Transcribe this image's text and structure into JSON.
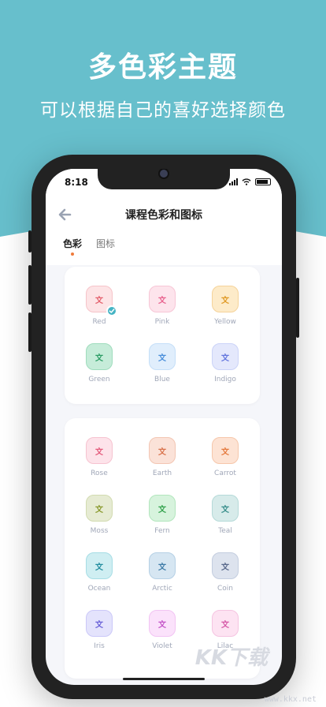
{
  "promo": {
    "title": "多色彩主题",
    "subtitle": "可以根据自己的喜好选择颜色"
  },
  "status": {
    "time": "8:18"
  },
  "nav": {
    "title": "课程色彩和图标",
    "tabs": [
      {
        "label": "色彩",
        "active": true
      },
      {
        "label": "图标",
        "active": false
      }
    ]
  },
  "glyph": "文",
  "card1": [
    {
      "label": "Red",
      "bg": "#fde4e6",
      "fg": "#e4606c",
      "border": "#f6c4c9",
      "selected": true
    },
    {
      "label": "Pink",
      "bg": "#fde4ec",
      "fg": "#e8628e",
      "border": "#f7c6d6",
      "selected": false
    },
    {
      "label": "Yellow",
      "bg": "#fdebc9",
      "fg": "#e09a26",
      "border": "#f5d39a",
      "selected": false
    },
    {
      "label": "Green",
      "bg": "#c6ecd9",
      "fg": "#2d9d66",
      "border": "#9fdcbd",
      "selected": false
    },
    {
      "label": "Blue",
      "bg": "#e0eefc",
      "fg": "#4a8fdb",
      "border": "#c5dff8",
      "selected": false
    },
    {
      "label": "Indigo",
      "bg": "#e4e8fc",
      "fg": "#6476de",
      "border": "#cbd3f8",
      "selected": false
    }
  ],
  "card2": [
    {
      "label": "Rose",
      "bg": "#fde3ea",
      "fg": "#e45b7c",
      "border": "#f6c3d0"
    },
    {
      "label": "Earth",
      "bg": "#fbe2d8",
      "fg": "#d9734c",
      "border": "#f3c6b3"
    },
    {
      "label": "Carrot",
      "bg": "#fde3d4",
      "fg": "#e57a3f",
      "border": "#f6c7ab"
    },
    {
      "label": "Moss",
      "bg": "#e6ebd3",
      "fg": "#8a9a2e",
      "border": "#d2dbb0"
    },
    {
      "label": "Fern",
      "bg": "#d7f3dd",
      "fg": "#35a34f",
      "border": "#b2e6bd"
    },
    {
      "label": "Teal",
      "bg": "#d7ebea",
      "fg": "#3a8f8c",
      "border": "#b5dad8"
    },
    {
      "label": "Ocean",
      "bg": "#cfeef2",
      "fg": "#238ea0",
      "border": "#a6dde5"
    },
    {
      "label": "Arctic",
      "bg": "#d6e6f2",
      "fg": "#3f7ca8",
      "border": "#b5d0e5"
    },
    {
      "label": "Coin",
      "bg": "#dde3ee",
      "fg": "#5a6a8c",
      "border": "#c3cddf"
    },
    {
      "label": "Iris",
      "bg": "#e4e3fc",
      "fg": "#6a62d8",
      "border": "#cbc8f8"
    },
    {
      "label": "Violet",
      "bg": "#fbe2fb",
      "fg": "#c455c8",
      "border": "#f2c4f3"
    },
    {
      "label": "Lilac",
      "bg": "#fde3f2",
      "fg": "#d659a7",
      "border": "#f5c4e1"
    }
  ],
  "watermark": {
    "big": "KK下载",
    "url": "www.kkx.net"
  }
}
